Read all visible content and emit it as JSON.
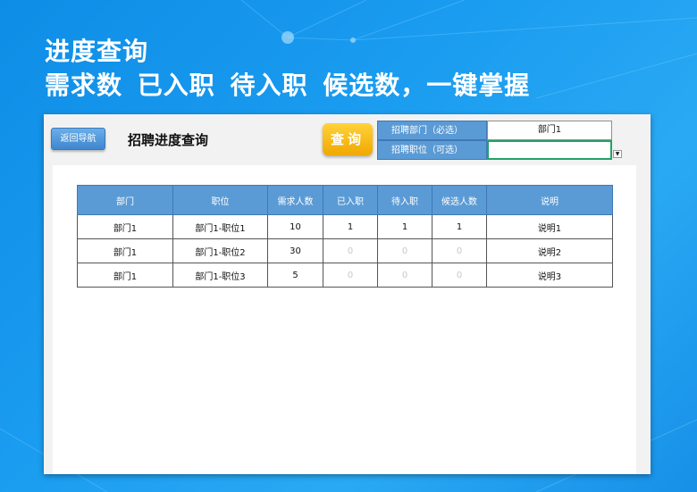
{
  "banner": {
    "line1": "进度查询",
    "line2": "需求数  已入职  待入职  候选数，一键掌握"
  },
  "sheet": {
    "back_label": "返回导航",
    "title": "招聘进度查询",
    "query_label": "查询",
    "filters": [
      {
        "label": "招聘部门（必选）",
        "value": "部门1"
      },
      {
        "label": "招聘职位（可选）",
        "value": ""
      }
    ]
  },
  "table": {
    "headers": [
      "部门",
      "职位",
      "需求人数",
      "已入职",
      "待入职",
      "候选人数",
      "说明"
    ],
    "rows": [
      [
        "部门1",
        "部门1-职位1",
        "10",
        "1",
        "1",
        "1",
        "说明1"
      ],
      [
        "部门1",
        "部门1-职位2",
        "30",
        "0",
        "0",
        "0",
        "说明2"
      ],
      [
        "部门1",
        "部门1-职位3",
        "5",
        "0",
        "0",
        "0",
        "说明3"
      ]
    ]
  },
  "colors": {
    "background": "#1a9cf0",
    "header_blue": "#5b9bd5",
    "query_yellow": "#f5b800",
    "active_cell": "#21a366"
  }
}
